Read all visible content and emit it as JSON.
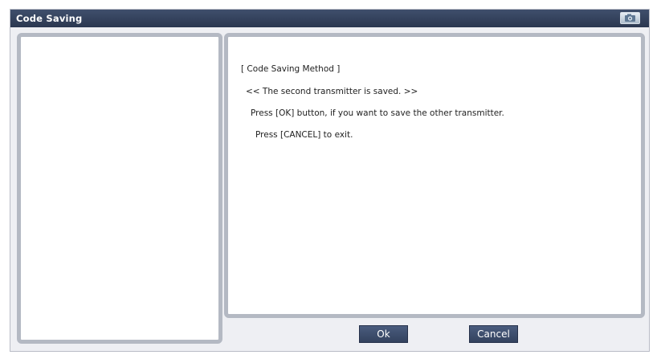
{
  "window": {
    "title": "Code Saving",
    "title_icon": "camera-icon",
    "colors": {
      "titlebar": "#2f3b55",
      "panel_border": "#b4b9c3",
      "button": "#3b4a68"
    }
  },
  "message": {
    "heading": "[ Code Saving Method ]",
    "status": "<< The second transmitter is saved. >>",
    "instruction_ok": "Press [OK] button, if you want to save the other transmitter.",
    "instruction_cancel": "Press [CANCEL] to exit."
  },
  "buttons": {
    "ok_label": "Ok",
    "cancel_label": "Cancel"
  }
}
